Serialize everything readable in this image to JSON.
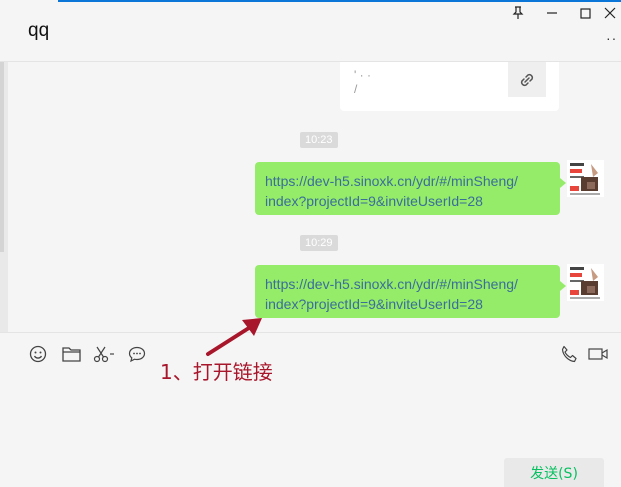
{
  "window": {
    "title": "qq"
  },
  "header": {
    "more_label": "··"
  },
  "chat": {
    "partial_card": {
      "fragment_1": "' ·  ·",
      "fragment_2": "/"
    },
    "messages": [
      {
        "time": "10:23",
        "line1": "https://dev-h5.sinoxk.cn/ydr/#/minSheng/",
        "line2": "index?projectId=9&inviteUserId=28"
      },
      {
        "time": "10:29",
        "line1": "https://dev-h5.sinoxk.cn/ydr/#/minSheng/",
        "line2": "index?projectId=9&inviteUserId=28"
      }
    ]
  },
  "annotation": {
    "text": "1、打开链接",
    "color": "#a8162b"
  },
  "input": {
    "send_label": "发送(S)"
  },
  "colors": {
    "bubble": "#95ec69",
    "link_text": "#3a6e9b",
    "send_text": "#07c160",
    "accent_line": "#0b76d8"
  }
}
